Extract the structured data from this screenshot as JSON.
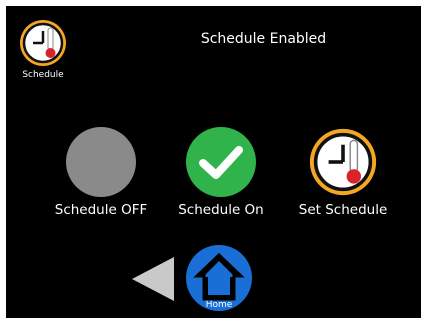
{
  "header": {
    "title": "Schedule Enabled"
  },
  "top_left": {
    "label": "Schedule",
    "icon": "clock-thermometer-icon"
  },
  "controls": [
    {
      "label": "Schedule OFF",
      "icon": "gray-circle-icon",
      "color": "#8a8a8a"
    },
    {
      "label": "Schedule On",
      "icon": "check-icon",
      "color": "#2fb34a"
    },
    {
      "label": "Set Schedule",
      "icon": "clock-thermometer-icon",
      "color": "#f5a623"
    }
  ],
  "nav": {
    "back_icon": "back-arrow-icon",
    "home_label": "Home",
    "home_icon": "home-icon",
    "home_color": "#1a6fd6"
  }
}
